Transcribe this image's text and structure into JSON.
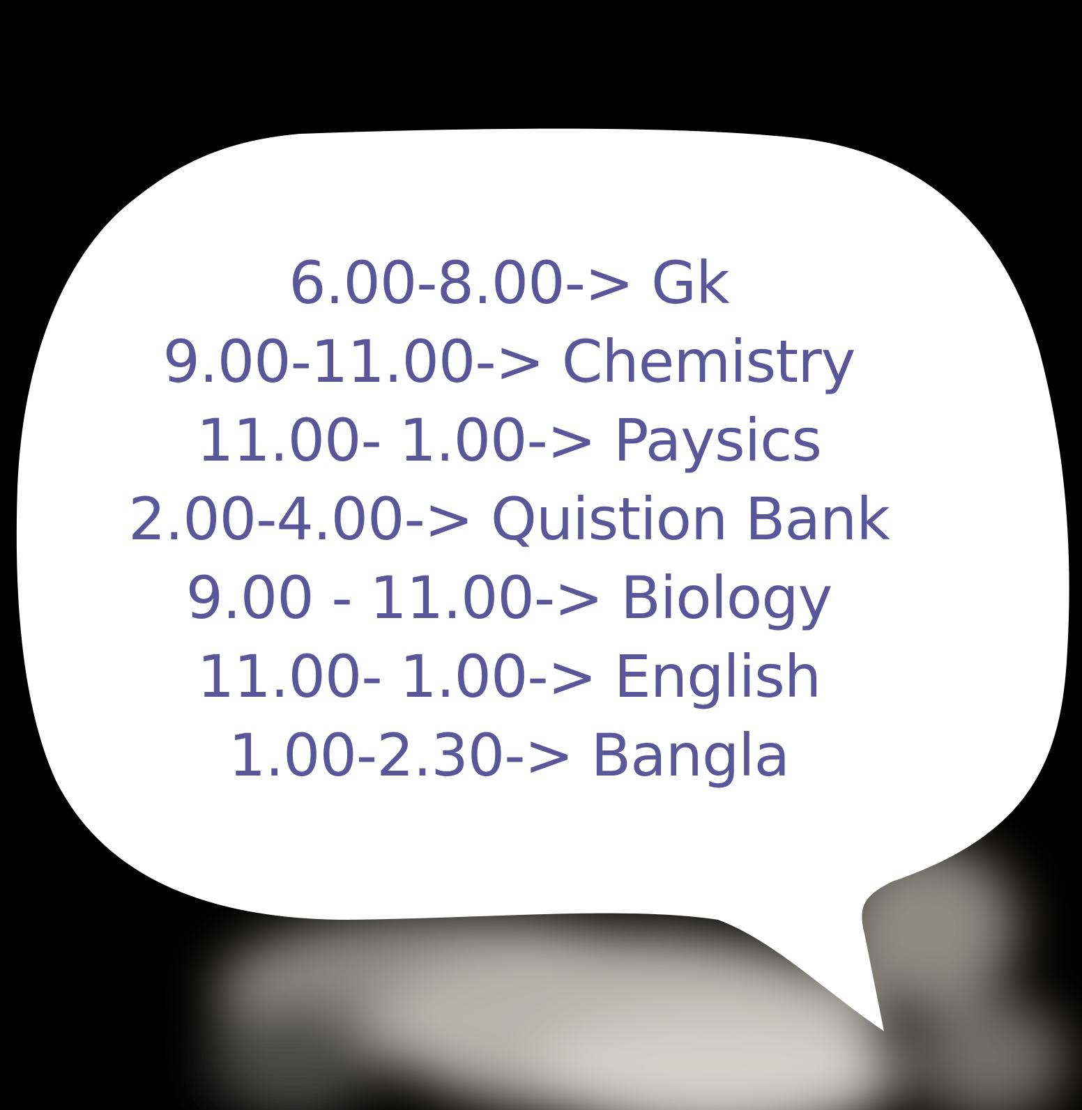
{
  "colors": {
    "background": "#000000",
    "bubble_fill": "#ffffff",
    "text": "#5b559a"
  },
  "schedule": {
    "lines": [
      "6.00-8.00-> Gk",
      "9.00-11.00-> Chemistry",
      "11.00- 1.00-> Paysics",
      "2.00-4.00-> Quistion Bank",
      "9.00 - 11.00-> Biology",
      "11.00- 1.00-> English",
      "1.00-2.30-> Bangla"
    ]
  }
}
